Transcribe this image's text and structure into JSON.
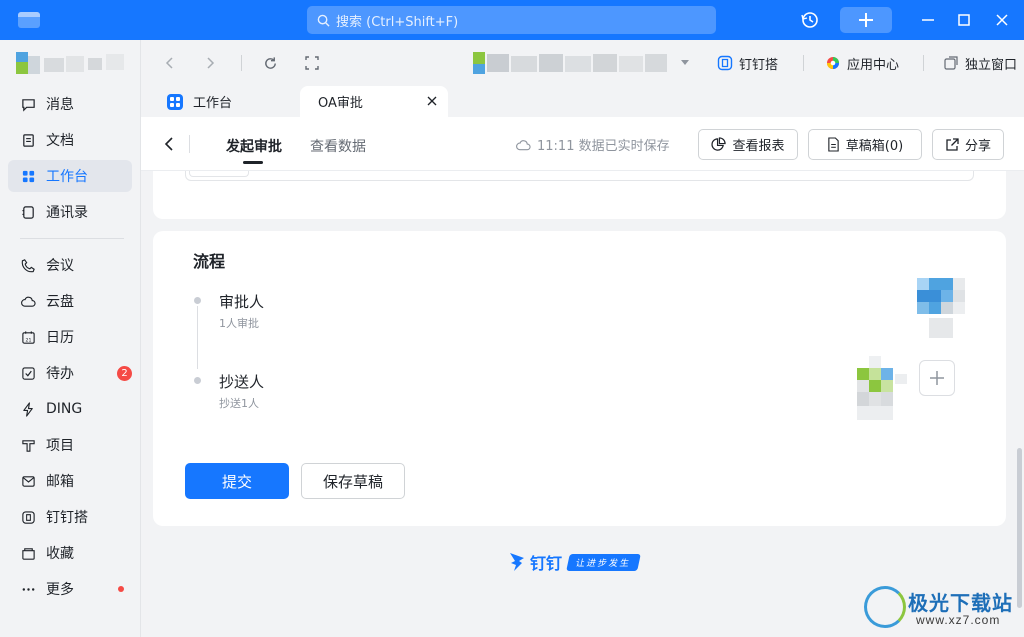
{
  "titlebar": {
    "search_placeholder": "搜索 (Ctrl+Shift+F)"
  },
  "sidebar": {
    "items": [
      {
        "label": "消息",
        "icon": "message-icon"
      },
      {
        "label": "文档",
        "icon": "document-icon"
      },
      {
        "label": "工作台",
        "icon": "workbench-icon",
        "active": true
      },
      {
        "label": "通讯录",
        "icon": "contacts-icon"
      },
      {
        "label": "会议",
        "icon": "phone-icon"
      },
      {
        "label": "云盘",
        "icon": "cloud-icon"
      },
      {
        "label": "日历",
        "icon": "calendar-icon"
      },
      {
        "label": "待办",
        "icon": "todo-icon",
        "badge": "2"
      },
      {
        "label": "DING",
        "icon": "lightning-icon"
      },
      {
        "label": "项目",
        "icon": "project-icon"
      },
      {
        "label": "邮箱",
        "icon": "mail-icon"
      },
      {
        "label": "钉钉搭",
        "icon": "builder-icon"
      },
      {
        "label": "收藏",
        "icon": "favorites-icon"
      },
      {
        "label": "更多",
        "icon": "more-icon",
        "dot": true
      }
    ]
  },
  "toplinks": {
    "dingda": "钉钉搭",
    "app_center": "应用中心",
    "standalone": "独立窗口"
  },
  "tabs": {
    "workbench": "工作台",
    "oa": "OA审批"
  },
  "toolbar": {
    "tab_start": "发起审批",
    "tab_data": "查看数据",
    "saved": "11:11 数据已实时保存",
    "report": "查看报表",
    "drafts": "草稿箱(0)",
    "share": "分享"
  },
  "flow": {
    "title": "流程",
    "approver": "审批人",
    "approver_sub": "1人审批",
    "cc": "抄送人",
    "cc_sub": "抄送1人"
  },
  "actions": {
    "submit": "提交",
    "save_draft": "保存草稿"
  },
  "footer": {
    "brand": "钉钉",
    "slogan": "让进步发生"
  },
  "watermark": {
    "title": "极光下载站",
    "url": "www.xz7.com"
  },
  "colors": {
    "accent": "#1677ff",
    "badge": "#f54a45"
  }
}
